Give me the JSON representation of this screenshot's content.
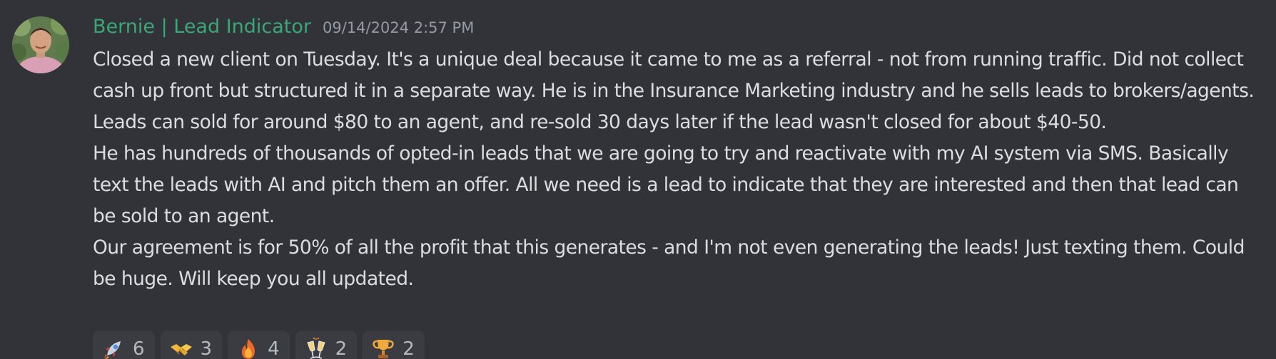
{
  "message": {
    "author": "Bernie | Lead Indicator",
    "timestamp": "09/14/2024 2:57 PM",
    "paragraphs": [
      "Closed a new client on Tuesday. It's a unique deal because it came to me as a referral  - not from running traffic. Did not collect cash up front but structured it in a separate way. He is in the Insurance Marketing industry and he sells leads to brokers/agents. Leads can sold for around $80 to an agent, and re-sold 30 days later if the lead wasn't closed for about $40-50.",
      "He has hundreds of thousands of opted-in leads that we are going to try and reactivate with my AI system via SMS. Basically text the leads with AI and pitch them an offer. All we need is a lead to indicate that they are interested and then that lead can be sold to an agent.",
      "Our agreement is for 50% of all the profit that this generates - and I'm not even generating the leads! Just texting them. Could be huge. Will keep you all updated."
    ]
  },
  "reactions": [
    {
      "icon": "rocket-icon",
      "count": "6"
    },
    {
      "icon": "handshake-icon",
      "count": "3"
    },
    {
      "icon": "fire-icon",
      "count": "4"
    },
    {
      "icon": "clinking-glasses-icon",
      "count": "2"
    },
    {
      "icon": "trophy-icon",
      "count": "2"
    }
  ]
}
